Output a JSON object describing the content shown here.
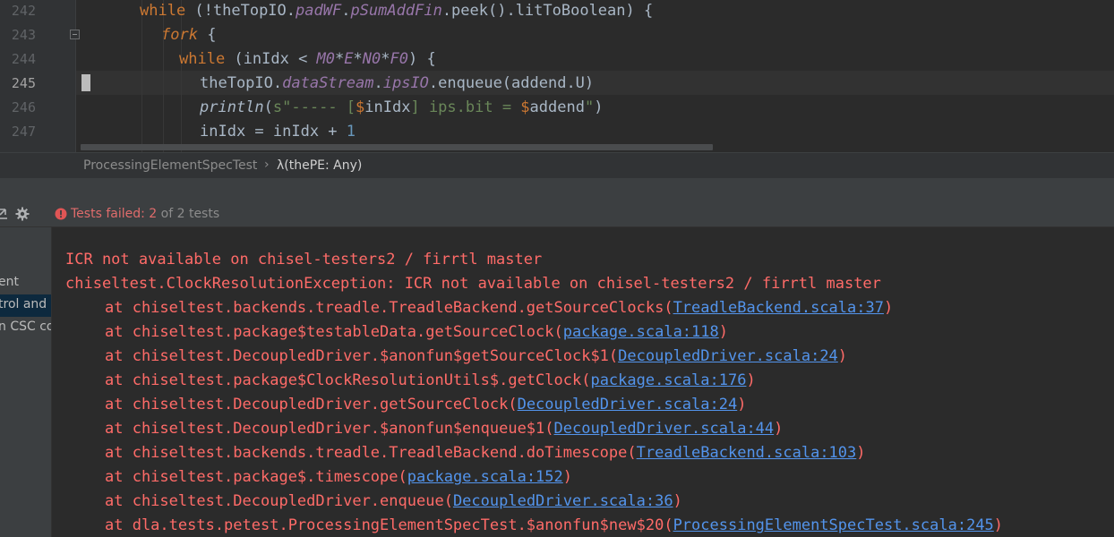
{
  "editor": {
    "line_numbers": [
      "242",
      "243",
      "244",
      "245",
      "246",
      "247"
    ],
    "lines": [
      {
        "segments": [
          {
            "t": "while",
            "c": "kw"
          },
          {
            "t": " (!theTopIO.",
            "c": ""
          },
          {
            "t": "padWF",
            "c": "fld"
          },
          {
            "t": ".",
            "c": ""
          },
          {
            "t": "pSumAddFin",
            "c": "fld"
          },
          {
            "t": ".peek().litToBoolean) {",
            "c": ""
          }
        ]
      },
      {
        "segments": [
          {
            "t": "fork",
            "c": "kw it"
          },
          {
            "t": " {",
            "c": ""
          }
        ]
      },
      {
        "segments": [
          {
            "t": "while",
            "c": "kw"
          },
          {
            "t": " (inIdx < ",
            "c": ""
          },
          {
            "t": "M0",
            "c": "fld"
          },
          {
            "t": "*",
            "c": ""
          },
          {
            "t": "E",
            "c": "fld"
          },
          {
            "t": "*",
            "c": ""
          },
          {
            "t": "N0",
            "c": "fld"
          },
          {
            "t": "*",
            "c": ""
          },
          {
            "t": "F0",
            "c": "fld"
          },
          {
            "t": ") {",
            "c": ""
          }
        ]
      },
      {
        "segments": [
          {
            "t": "theTopIO.",
            "c": ""
          },
          {
            "t": "dataStream",
            "c": "fld"
          },
          {
            "t": ".",
            "c": ""
          },
          {
            "t": "ipsIO",
            "c": "fld"
          },
          {
            "t": ".enqueue(addend.U)",
            "c": ""
          }
        ]
      },
      {
        "segments": [
          {
            "t": "println",
            "c": "it"
          },
          {
            "t": "(",
            "c": ""
          },
          {
            "t": "s\"----- [",
            "c": "str"
          },
          {
            "t": "$",
            "c": "ip"
          },
          {
            "t": "inIdx",
            "c": ""
          },
          {
            "t": "] ips.bit = ",
            "c": "str"
          },
          {
            "t": "$",
            "c": "ip"
          },
          {
            "t": "addend",
            "c": ""
          },
          {
            "t": "\"",
            "c": "str"
          },
          {
            "t": ")",
            "c": ""
          }
        ]
      },
      {
        "segments": [
          {
            "t": "inIdx = inIdx + ",
            "c": ""
          },
          {
            "t": "1",
            "c": "num"
          }
        ]
      }
    ]
  },
  "breadcrumb": {
    "file": "ProcessingElementSpecTest",
    "separator": "›",
    "function": "λ(thePE: Any)"
  },
  "run_toolbar": {
    "status_prefix": "Tests failed:",
    "failed_count": "2",
    "status_suffix": "of 2 tests"
  },
  "test_tree": {
    "items": [
      "ent",
      "trol and C",
      "n CSC cor"
    ]
  },
  "console": {
    "error_lines": [
      "ICR not available on chisel-testers2 / firrtl master",
      "chiseltest.ClockResolutionException: ICR not available on chisel-testers2 / firrtl master"
    ],
    "trace": [
      {
        "prefix": "at chiseltest.backends.treadle.TreadleBackend.getSourceClocks(",
        "link": "TreadleBackend.scala:37",
        "suffix": ")"
      },
      {
        "prefix": "at chiseltest.package$testableData.getSourceClock(",
        "link": "package.scala:118",
        "suffix": ")"
      },
      {
        "prefix": "at chiseltest.DecoupledDriver.$anonfun$getSourceClock$1(",
        "link": "DecoupledDriver.scala:24",
        "suffix": ")"
      },
      {
        "prefix": "at chiseltest.package$ClockResolutionUtils$.getClock(",
        "link": "package.scala:176",
        "suffix": ")"
      },
      {
        "prefix": "at chiseltest.DecoupledDriver.getSourceClock(",
        "link": "DecoupledDriver.scala:24",
        "suffix": ")"
      },
      {
        "prefix": "at chiseltest.DecoupledDriver.$anonfun$enqueue$1(",
        "link": "DecoupledDriver.scala:44",
        "suffix": ")"
      },
      {
        "prefix": "at chiseltest.backends.treadle.TreadleBackend.doTimescope(",
        "link": "TreadleBackend.scala:103",
        "suffix": ")"
      },
      {
        "prefix": "at chiseltest.package$.timescope(",
        "link": "package.scala:152",
        "suffix": ")"
      },
      {
        "prefix": "at chiseltest.DecoupledDriver.enqueue(",
        "link": "DecoupledDriver.scala:36",
        "suffix": ")"
      },
      {
        "prefix": "at dla.tests.petest.ProcessingElementSpecTest.$anonfun$new$20(",
        "link": "ProcessingElementSpecTest.scala:245",
        "suffix": ")"
      }
    ]
  },
  "colors": {
    "editor_bg": "#2b2b2b",
    "keyword": "#cc7832",
    "field": "#9876aa",
    "string": "#6a8759",
    "number": "#6897bb",
    "error_text": "#ff6b68",
    "link": "#5394ec"
  },
  "icons": [
    "fold-marker-icon",
    "expand-icon",
    "gear-icon",
    "error-icon"
  ]
}
